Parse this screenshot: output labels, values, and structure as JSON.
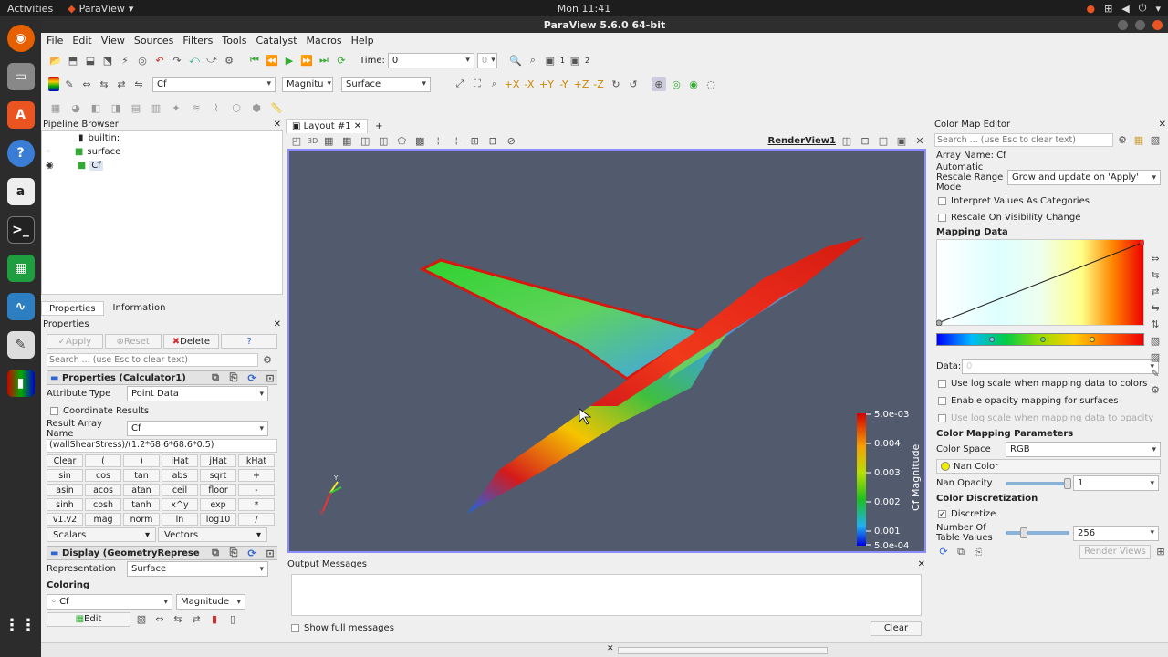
{
  "system": {
    "activities": "Activities",
    "app_name": "ParaView",
    "clock": "Mon 11:41"
  },
  "window": {
    "title": "ParaView 5.6.0 64-bit"
  },
  "menu": [
    "File",
    "Edit",
    "View",
    "Sources",
    "Filters",
    "Tools",
    "Catalyst",
    "Macros",
    "Help"
  ],
  "toolbar": {
    "time_label": "Time:",
    "time_value": "0",
    "time_index": "0",
    "array_name": "Cf",
    "component": "Magnitu",
    "representation": "Surface",
    "cam1": "1",
    "cam2": "2"
  },
  "pipeline": {
    "title": "Pipeline Browser",
    "items": [
      "builtin:",
      "surface",
      "Cf"
    ]
  },
  "properties": {
    "tabs": [
      "Properties",
      "Information"
    ],
    "title": "Properties",
    "apply": "Apply",
    "reset": "Reset",
    "delete": "Delete",
    "help": "?",
    "search_placeholder": "Search ... (use Esc to clear text)",
    "section1": "Properties (Calculator1)",
    "attribute_type_label": "Attribute Type",
    "attribute_type_value": "Point Data",
    "coordinate_results": "Coordinate Results",
    "result_array_label": "Result Array Name",
    "result_array_value": "Cf",
    "expression": "(wallShearStress)/(1.2*68.6*68.6*0.5)",
    "calc_rows": [
      [
        "Clear",
        "(",
        ")",
        "iHat",
        "jHat",
        "kHat"
      ],
      [
        "sin",
        "cos",
        "tan",
        "abs",
        "sqrt",
        "+"
      ],
      [
        "asin",
        "acos",
        "atan",
        "ceil",
        "floor",
        "-"
      ],
      [
        "sinh",
        "cosh",
        "tanh",
        "x^y",
        "exp",
        "*"
      ],
      [
        "v1.v2",
        "mag",
        "norm",
        "ln",
        "log10",
        "/"
      ]
    ],
    "scalars": "Scalars",
    "vectors": "Vectors",
    "section2": "Display (GeometryReprese",
    "representation_label": "Representation",
    "representation_value": "Surface",
    "coloring_label": "Coloring",
    "coloring_array": "Cf",
    "coloring_component": "Magnitude",
    "edit": "Edit"
  },
  "layout": {
    "tab": "Layout #1",
    "add": "+",
    "view_name": "RenderView1",
    "view_3d": "3D"
  },
  "colorbar": {
    "title": "Cf Magnitude",
    "labels": [
      "5.0e-03",
      "0.004",
      "0.003",
      "0.002",
      "0.001",
      "5.0e-04"
    ]
  },
  "output": {
    "title": "Output Messages",
    "show_full": "Show full messages",
    "clear": "Clear"
  },
  "cme": {
    "title": "Color Map Editor",
    "search_placeholder": "Search ... (use Esc to clear text)",
    "array_name": "Array Name: Cf",
    "auto_rescale_label": "Automatic Rescale Range Mode",
    "auto_rescale_value": "Grow and update on 'Apply'",
    "interpret": "Interpret Values As Categories",
    "rescale_visibility": "Rescale On Visibility Change",
    "mapping_data": "Mapping Data",
    "data_label": "Data:",
    "data_value": "0",
    "log_scale": "Use log scale when mapping data to colors",
    "opacity_surfaces": "Enable opacity mapping for surfaces",
    "log_opacity": "Use log scale when mapping data to opacity",
    "params": "Color Mapping Parameters",
    "color_space_label": "Color Space",
    "color_space_value": "RGB",
    "nan_color": "Nan Color",
    "nan_opacity_label": "Nan Opacity",
    "nan_opacity_value": "1",
    "discretization": "Color Discretization",
    "discretize": "Discretize",
    "table_values_label": "Number Of Table Values",
    "table_values_value": "256",
    "render_views": "Render Views"
  },
  "colors": {
    "accent": "#e95420",
    "view_bg": "#525a6e",
    "view_border": "#8a8cff"
  }
}
